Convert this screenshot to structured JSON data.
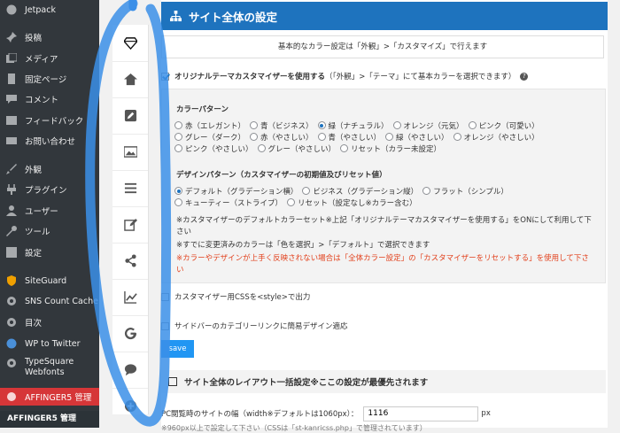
{
  "sidebar": {
    "items": [
      {
        "label": "Jetpack",
        "icon": "jetpack-icon"
      },
      {
        "label": "投稿",
        "icon": "pin-icon"
      },
      {
        "label": "メディア",
        "icon": "media-icon"
      },
      {
        "label": "固定ページ",
        "icon": "page-icon"
      },
      {
        "label": "コメント",
        "icon": "comment-icon"
      },
      {
        "label": "フィードバック",
        "icon": "feedback-icon"
      },
      {
        "label": "お問い合わせ",
        "icon": "mail-icon"
      },
      {
        "label": "外観",
        "icon": "brush-icon"
      },
      {
        "label": "プラグイン",
        "icon": "plugin-icon"
      },
      {
        "label": "ユーザー",
        "icon": "user-icon"
      },
      {
        "label": "ツール",
        "icon": "wrench-icon"
      },
      {
        "label": "設定",
        "icon": "settings-icon"
      },
      {
        "label": "SiteGuard",
        "icon": "shield-icon"
      },
      {
        "label": "SNS Count Cache",
        "icon": "gear-icon"
      },
      {
        "label": "目次",
        "icon": "gear-icon"
      },
      {
        "label": "WP to Twitter",
        "icon": "wp-icon"
      },
      {
        "label": "TypeSquare Webfonts",
        "icon": "gear-icon"
      },
      {
        "label": "AFFINGER5 管理",
        "icon": "affinger-icon"
      }
    ],
    "submenu_title": "AFFINGER5 管理"
  },
  "tabs": [
    "diamond-icon",
    "home-icon",
    "pencil-icon",
    "image-icon",
    "list-icon",
    "edit-icon",
    "share-icon",
    "chart-icon",
    "google-icon",
    "speech-bubble-icon",
    "plus-icon"
  ],
  "main": {
    "header_title": "サイト全体の設定",
    "notice": "基本的なカラー設定は「外観」>「カスタマイズ」で行えます",
    "original_customizer": {
      "label_bold": "オリジナルテーマカスタマイザーを使用する",
      "label_rest": "（「外観」>「テーマ」にて基本カラーを選択できます）"
    },
    "color_pattern": {
      "title": "カラーパターン",
      "options": [
        "赤（エレガント）",
        "青（ビジネス）",
        "緑（ナチュラル）",
        "オレンジ（元気）",
        "ピンク（可愛い）",
        "グレー（ダーク）",
        "赤（やさしい）",
        "青（やさしい）",
        "緑（やさしい）",
        "オレンジ（やさしい）",
        "ピンク（やさしい）",
        "グレー（やさしい）",
        "リセット（カラー未設定）"
      ],
      "selected": 2
    },
    "design_pattern": {
      "title": "デザインパターン（カスタマイザーの初期値及びリセット値）",
      "options": [
        "デフォルト（グラデーション横）",
        "ビジネス（グラデーション縦）",
        "フラット（シンプル）",
        "キューティー（ストライプ）",
        "リセット（設定なし※カラー含む）"
      ],
      "selected": 0
    },
    "notes": [
      "※カスタマイザーのデフォルトカラーセット※上記「オリジナルテーマカスタマイザーを使用する」をONにして利用して下さい",
      "※すでに変更済みのカラーは「色を選択」>「デフォルト」で選択できます"
    ],
    "warning": "※カラーやデザインが上手く反映されない場合は「全体カラー設定」の「カスタマイザーをリセットする」を使用して下さい",
    "css_output": "カスタマイザー用CSSを<style>で出力",
    "sidebar_category": "サイドバーのカテゴリーリンクに簡易デザイン適応",
    "save_label": "save",
    "layout_section_title": "サイト全体のレイアウト一括設定※ここの設定が最優先されます",
    "pc_width_label": "PC閲覧時のサイトの幅（width※デフォルトは1060px）：",
    "pc_width_value": "1116",
    "pc_width_unit": "px",
    "cut_off_text": "※960px以上で設定して下さい（CSSは「st-kanricss.php」で管理されています）"
  },
  "colors": {
    "header_blue": "#1e73be",
    "highlight_blue": "#3b8fe8",
    "sidebar_bg": "#32373c",
    "active_red": "#d63638"
  }
}
